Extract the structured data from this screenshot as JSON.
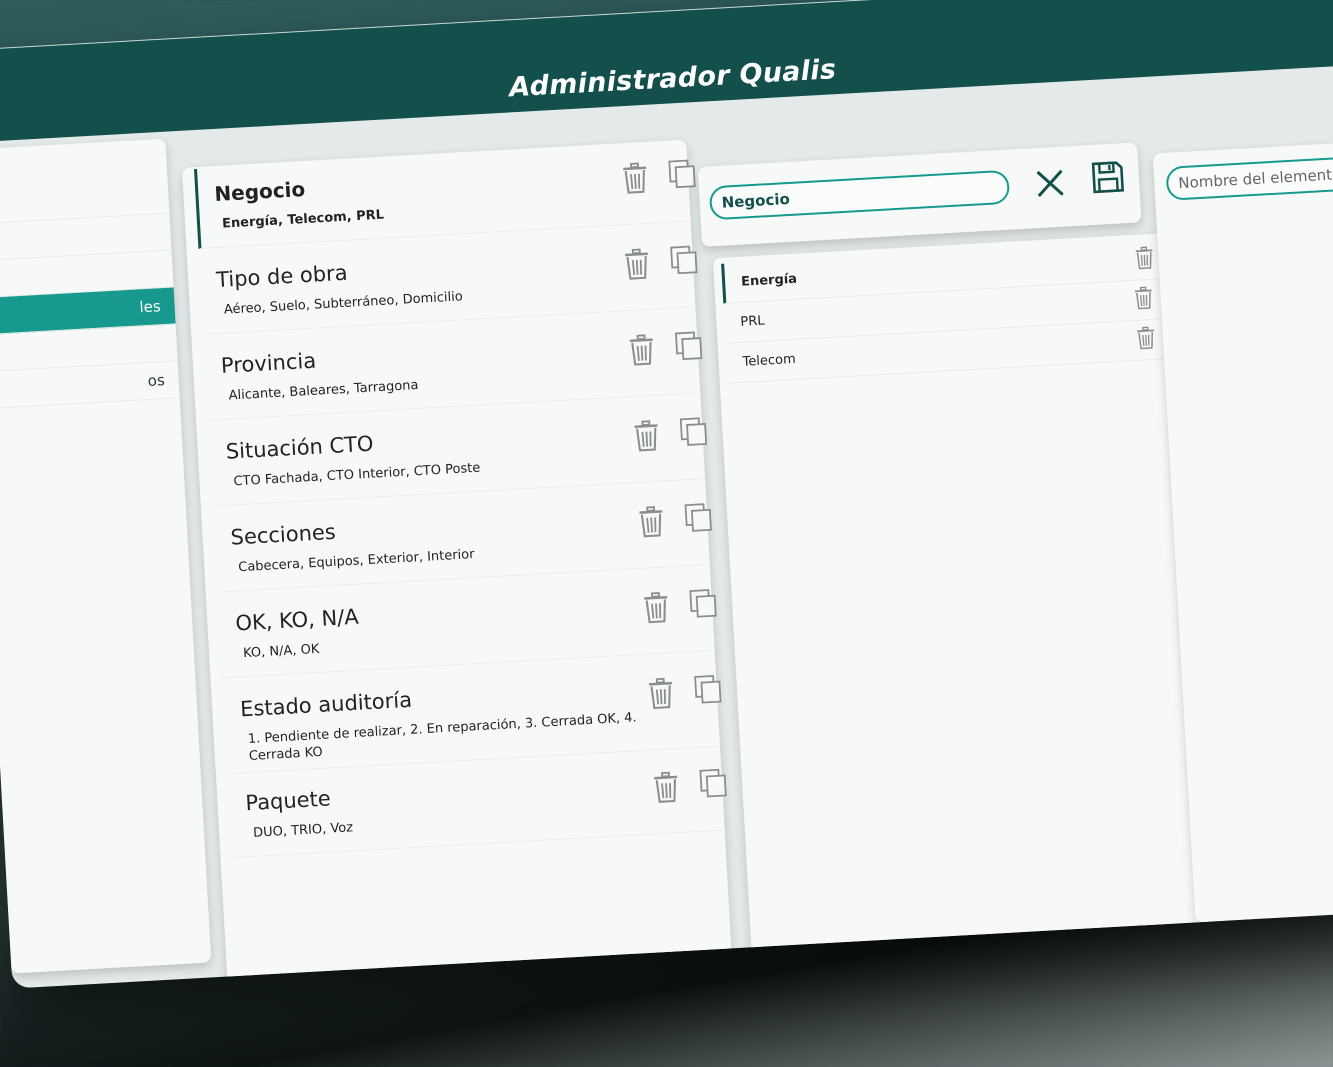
{
  "app": {
    "title": "Administrador Qualis"
  },
  "nav": {
    "items": [
      {
        "label": "",
        "active": false
      },
      {
        "label": "",
        "active": false
      },
      {
        "label": "",
        "active": false
      },
      {
        "label": "les",
        "active": true
      },
      {
        "label": "",
        "active": false
      },
      {
        "label": "os",
        "active": false
      }
    ]
  },
  "catalogs": [
    {
      "title": "Negocio",
      "values": "Energía, Telecom, PRL",
      "selected": true
    },
    {
      "title": "Tipo de obra",
      "values": "Aéreo, Suelo, Subterráneo, Domicilio",
      "selected": false
    },
    {
      "title": "Provincia",
      "values": "Alicante, Baleares, Tarragona",
      "selected": false
    },
    {
      "title": "Situación CTO",
      "values": "CTO Fachada, CTO Interior, CTO Poste",
      "selected": false
    },
    {
      "title": "Secciones",
      "values": "Cabecera, Equipos, Exterior, Interior",
      "selected": false
    },
    {
      "title": "OK, KO, N/A",
      "values": "KO, N/A, OK",
      "selected": false
    },
    {
      "title": "Estado auditoría",
      "values": "1. Pendiente de realizar, 2. En reparación, 3. Cerrada OK, 4. Cerrada KO",
      "selected": false
    },
    {
      "title": "Paquete",
      "values": "DUO, TRIO, Voz",
      "selected": false
    }
  ],
  "editor": {
    "name_value": "Negocio",
    "values": [
      {
        "label": "Energía",
        "selected": true
      },
      {
        "label": "PRL",
        "selected": false
      },
      {
        "label": "Telecom",
        "selected": false
      }
    ]
  },
  "detail": {
    "name_placeholder": "Nombre del elemento"
  },
  "colors": {
    "header": "#134f4b",
    "accent": "#179a8d",
    "panel": "#f7f9f8"
  },
  "icons": {
    "delete": "trash-icon",
    "duplicate": "copy-icon",
    "close": "close-icon",
    "save": "save-icon"
  }
}
